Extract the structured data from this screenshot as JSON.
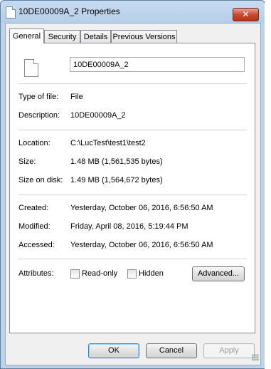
{
  "window": {
    "title": "10DE00009A_2 Properties",
    "close_glyph": "✕"
  },
  "tabs": [
    {
      "label": "General",
      "active": true
    },
    {
      "label": "Security",
      "active": false
    },
    {
      "label": "Details",
      "active": false
    },
    {
      "label": "Previous Versions",
      "active": false
    }
  ],
  "file": {
    "icon": "document-icon",
    "name_value": "10DE00009A_2"
  },
  "properties": {
    "type_label": "Type of file:",
    "type_value": "File",
    "description_label": "Description:",
    "description_value": "10DE00009A_2",
    "location_label": "Location:",
    "location_value": "C:\\LucTest\\test1\\test2",
    "size_label": "Size:",
    "size_value": "1.48 MB (1,561,535 bytes)",
    "size_on_disk_label": "Size on disk:",
    "size_on_disk_value": "1.49 MB (1,564,672 bytes)",
    "created_label": "Created:",
    "created_value": "Yesterday, October 06, 2016, 6:56:50 AM",
    "modified_label": "Modified:",
    "modified_value": "Friday, April 08, 2016, 5:19:44 PM",
    "accessed_label": "Accessed:",
    "accessed_value": "Yesterday, October 06, 2016, 6:56:50 AM"
  },
  "attributes": {
    "label": "Attributes:",
    "readonly_label": "Read-only",
    "readonly_checked": false,
    "hidden_label": "Hidden",
    "hidden_checked": false,
    "advanced_label": "Advanced..."
  },
  "buttons": {
    "ok_label": "OK",
    "cancel_label": "Cancel",
    "apply_label": "Apply"
  }
}
